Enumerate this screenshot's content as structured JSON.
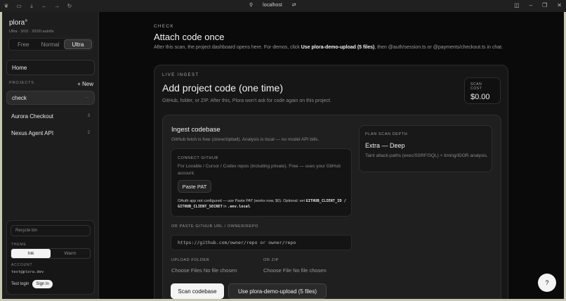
{
  "browser": {
    "url_host": "localhost",
    "icons": [
      "tree-icon",
      "sidebar-icon",
      "download-icon",
      "back-icon",
      "forward-icon",
      "reload-icon"
    ]
  },
  "sidebar": {
    "brand": "plora°",
    "plan_usage": "Ultra · 3/10 · 20/20 autofix",
    "tiers": [
      "Free",
      "Normal",
      "Ultra"
    ],
    "active_tier": "Ultra",
    "home_label": "Home",
    "projects_heading": "PROJECTS",
    "new_label": "+ New",
    "projects": [
      {
        "name": "check",
        "count": "···",
        "active": true
      },
      {
        "name": "Aurora Checkout",
        "count": "3",
        "active": false
      },
      {
        "name": "Nexus Agent API",
        "count": "2",
        "active": false
      }
    ],
    "recycle_label": "Recycle bin",
    "theme_heading": "THEME",
    "themes": [
      "Ink",
      "Warm"
    ],
    "active_theme": "Ink",
    "account_heading": "ACCOUNT",
    "account_email": "test@plora.dev",
    "test_login_label": "Test login",
    "sign_in_label": "Sign in"
  },
  "main": {
    "eyebrow": "CHECK",
    "title": "Attach code once",
    "intro_prefix": "After this scan, the project dashboard opens here. For demos, click ",
    "intro_link": "Use plora-demo-upload (5 files)",
    "intro_suffix": ", then @auth/session.ts or @payments/checkout.ts in chat.",
    "card": {
      "eyebrow": "LIVE INGEST",
      "title": "Add project code (one time)",
      "desc": "GitHub, folder, or ZIP. After this, Plora won't ask for code again on this project.",
      "cost_label": "SCAN COST",
      "cost_value": "$0.00",
      "ingest": {
        "title": "Ingest codebase",
        "desc": "GitHub fetch is free (clone/zipball). Analysis is local — no model API bills.",
        "connect_label": "CONNECT GITHUB",
        "connect_desc": "For Lovable / Cursor / Codex repos (including private). Free — uses your GitHub account.",
        "paste_pat": "Paste PAT",
        "oauth_text_1": "OAuth app not configured — use Paste PAT (works now, $0). Optional: set ",
        "oauth_code_1": "GITHUB_CLIENT_ID",
        "oauth_sep": " / ",
        "oauth_code_2": "GITHUB_CLIENT_SECRET",
        "oauth_text_2": " in ",
        "oauth_code_3": ".env.local",
        "oauth_end": ".",
        "or_paste_label": "OR PASTE GITHUB URL / OWNER/REPO",
        "url_placeholder": "https://github.com/owner/repo or owner/repo",
        "upload_folder_label": "UPLOAD FOLDER",
        "upload_folder_value": "Choose Files No file chosen",
        "zip_label": "OR ZIP",
        "zip_value": "Choose File No file chosen",
        "scan_button": "Scan codebase",
        "demo_button": "Use plora-demo-upload (5 files)"
      },
      "depth": {
        "label": "PLAN SCAN DEPTH",
        "value": "Extra — Deep",
        "desc": "Taint attack-paths (exec/SSRF/SQL) + timing/IDOR analysis."
      }
    }
  },
  "help_label": "?"
}
